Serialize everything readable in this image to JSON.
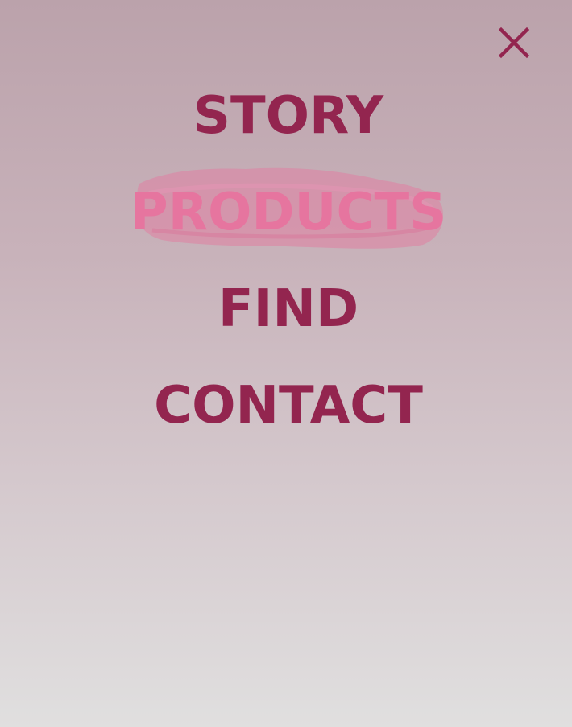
{
  "menu": {
    "items": [
      {
        "label": "STORY"
      },
      {
        "label": "PRODUCTS",
        "active": true
      },
      {
        "label": "FIND"
      },
      {
        "label": "CONTACT"
      }
    ]
  },
  "close_icon": "close-icon",
  "colors": {
    "text": "#93254f",
    "active_text": "#e6759f",
    "brush": "#e07fa3",
    "background_top": "#bba2ab",
    "background_bottom": "#e0dfdf"
  }
}
